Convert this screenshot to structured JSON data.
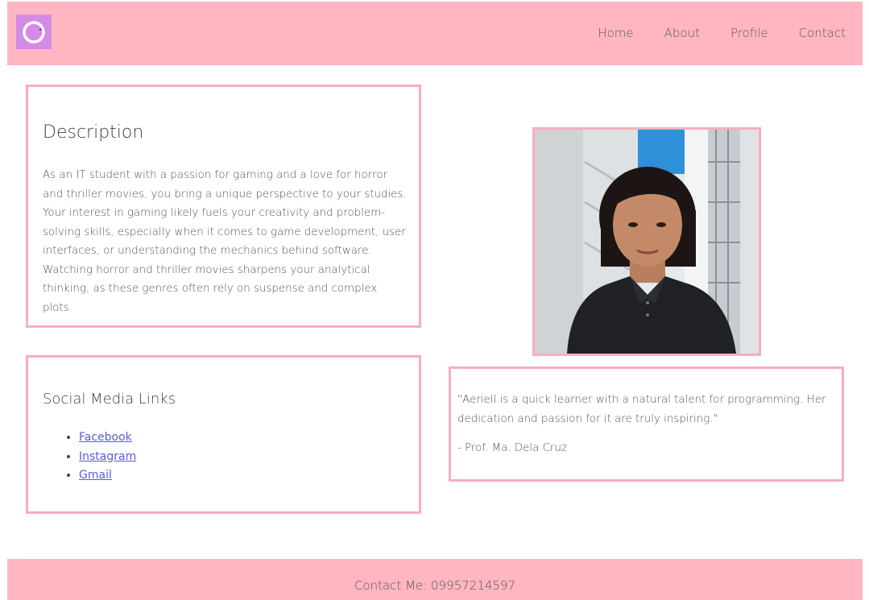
{
  "header": {
    "logo_icon": "circle-logo-icon",
    "nav": [
      {
        "label": "Home"
      },
      {
        "label": "About"
      },
      {
        "label": "Profile"
      },
      {
        "label": "Contact"
      }
    ]
  },
  "description": {
    "title": "Description",
    "text": "As an IT student with a passion for gaming and a love for horror and thriller movies, you bring a unique perspective to your studies. Your interest in gaming likely fuels your creativity and problem-solving skills, especially when it comes to game development, user interfaces, or understanding the mechanics behind software. Watching horror and thriller movies sharpens your analytical thinking, as these genres often rely on suspense and complex plots."
  },
  "social": {
    "title": "Social Media Links",
    "links": [
      {
        "label": "Facebook"
      },
      {
        "label": "Instagram"
      },
      {
        "label": "Gmail"
      }
    ]
  },
  "testimonial": {
    "quote": "\"Aeriell is a quick learner with a natural talent for programming. Her dedication and passion for it are truly inspiring.\"",
    "author": "- Prof. Ma. Dela Cruz"
  },
  "footer": {
    "contact_text": "Contact Me: 09957214597"
  },
  "colors": {
    "header_bg": "#ffb6c1",
    "border": "#f7aec0",
    "logo_bg": "#d48be5",
    "link": "#5b5bd6"
  }
}
